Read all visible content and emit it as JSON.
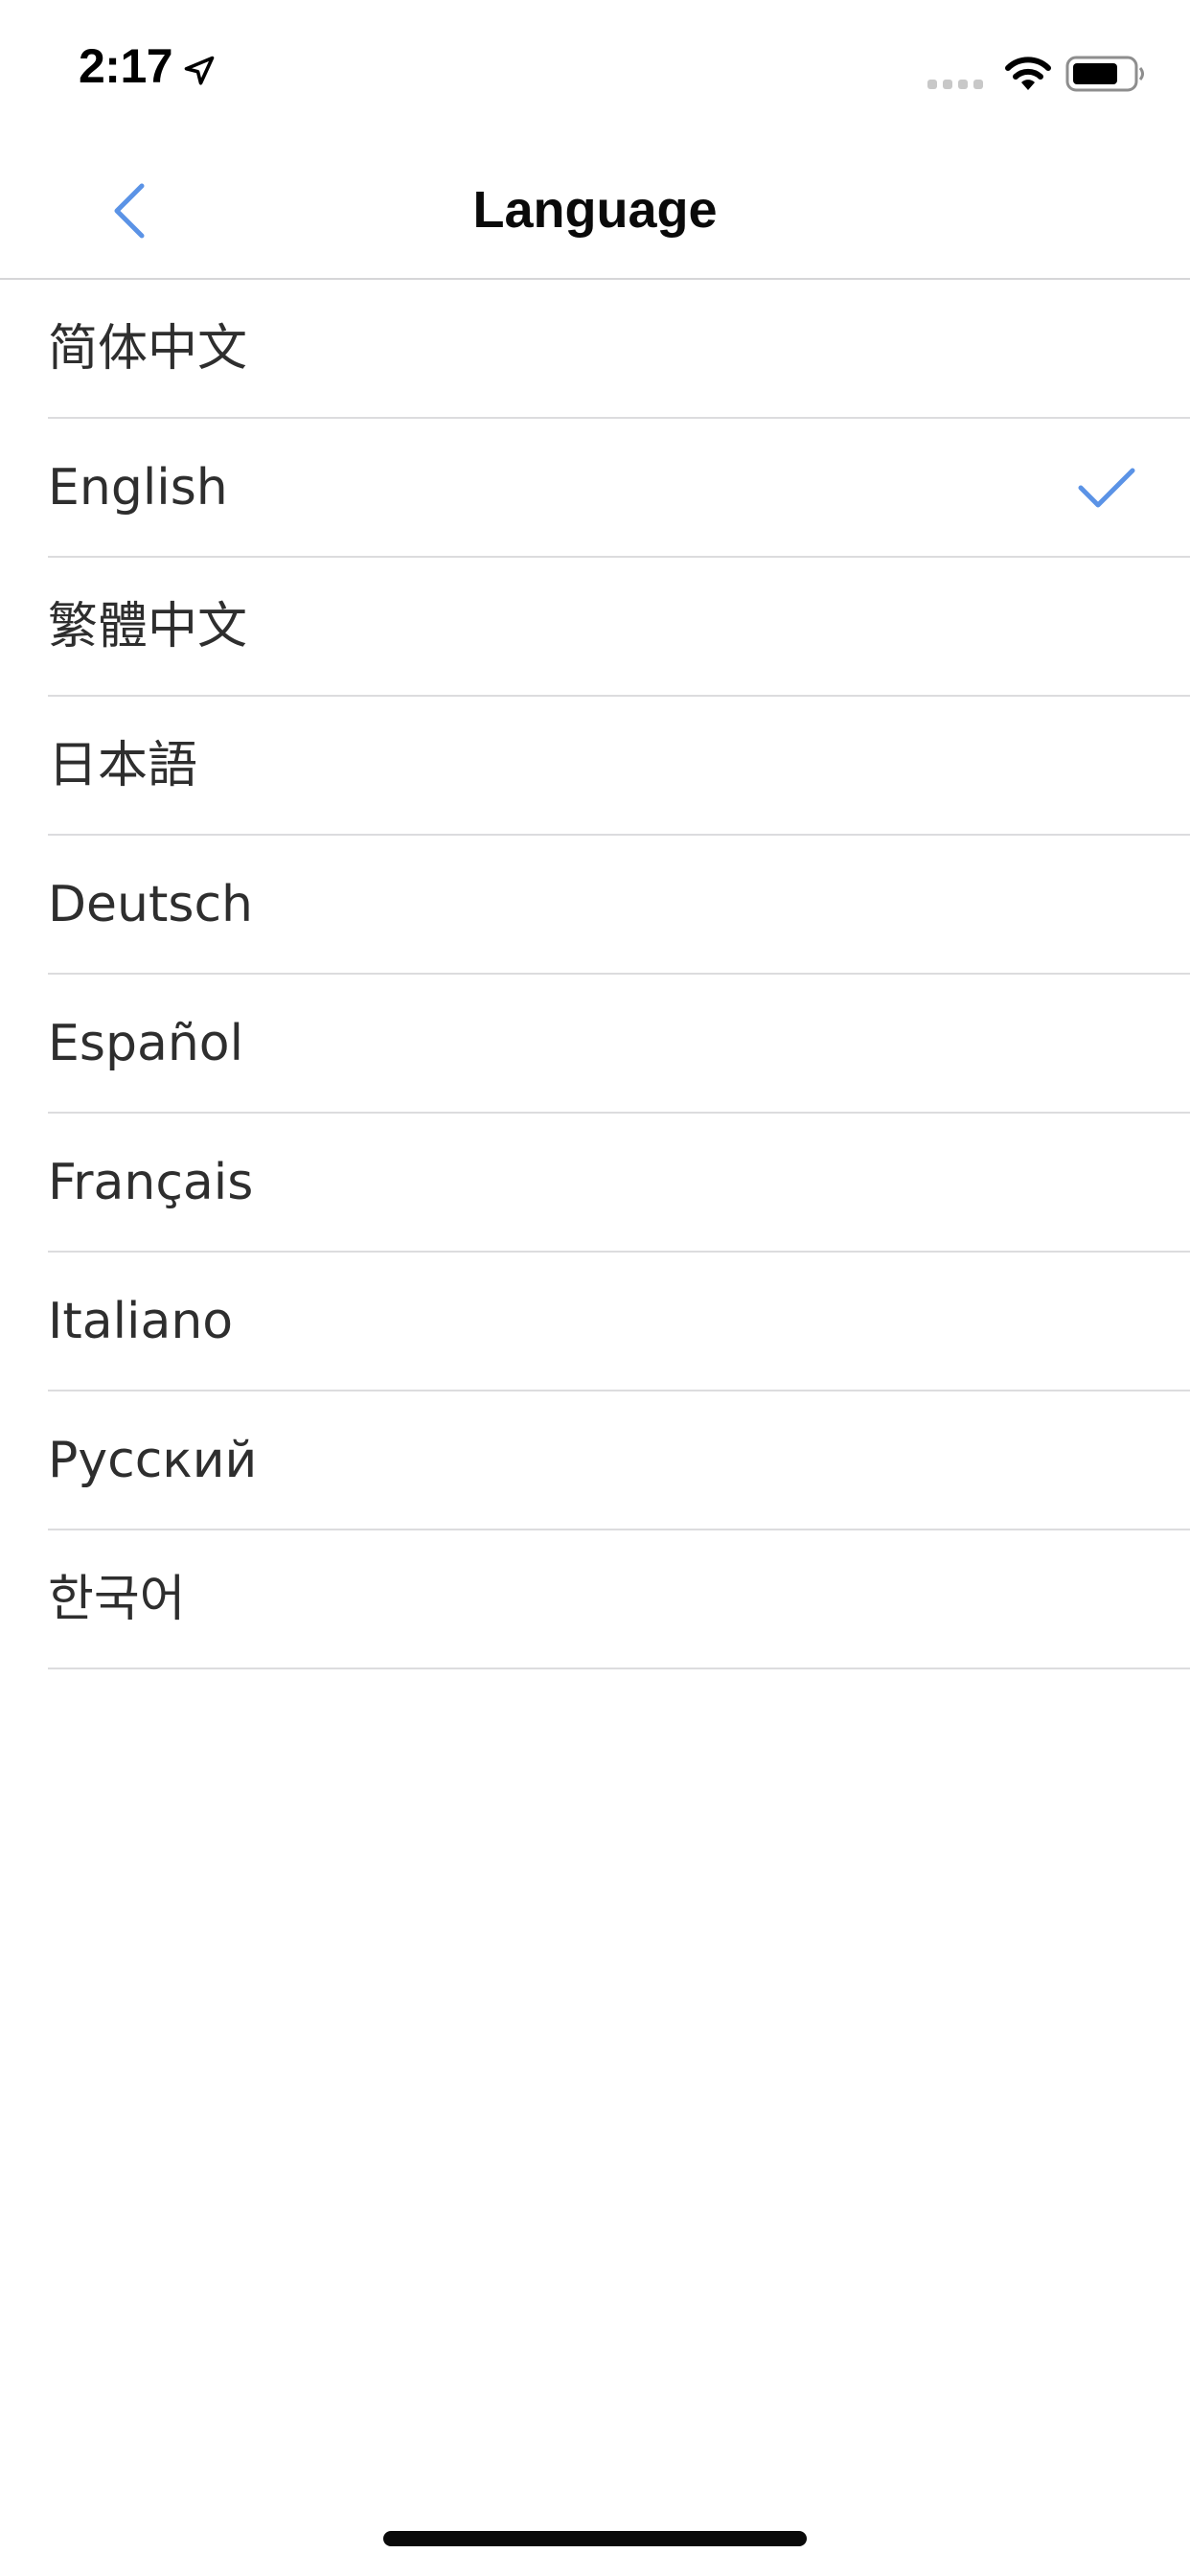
{
  "status_bar": {
    "time": "2:17",
    "icons": [
      "location-arrow-icon",
      "cellular-signal-icon",
      "wifi-icon",
      "battery-icon"
    ]
  },
  "nav": {
    "title": "Language",
    "back_icon": "chevron-left-icon"
  },
  "languages": [
    {
      "label": "简体中文",
      "selected": false
    },
    {
      "label": "English",
      "selected": true
    },
    {
      "label": "繁體中文",
      "selected": false
    },
    {
      "label": "日本語",
      "selected": false
    },
    {
      "label": "Deutsch",
      "selected": false
    },
    {
      "label": "Español",
      "selected": false
    },
    {
      "label": "Français",
      "selected": false
    },
    {
      "label": "Italiano",
      "selected": false
    },
    {
      "label": "Русский",
      "selected": false
    },
    {
      "label": "한국어",
      "selected": false
    }
  ],
  "colors": {
    "accent": "#5b93e6",
    "text": "#2e2e2e",
    "separator": "#dcdcde"
  }
}
